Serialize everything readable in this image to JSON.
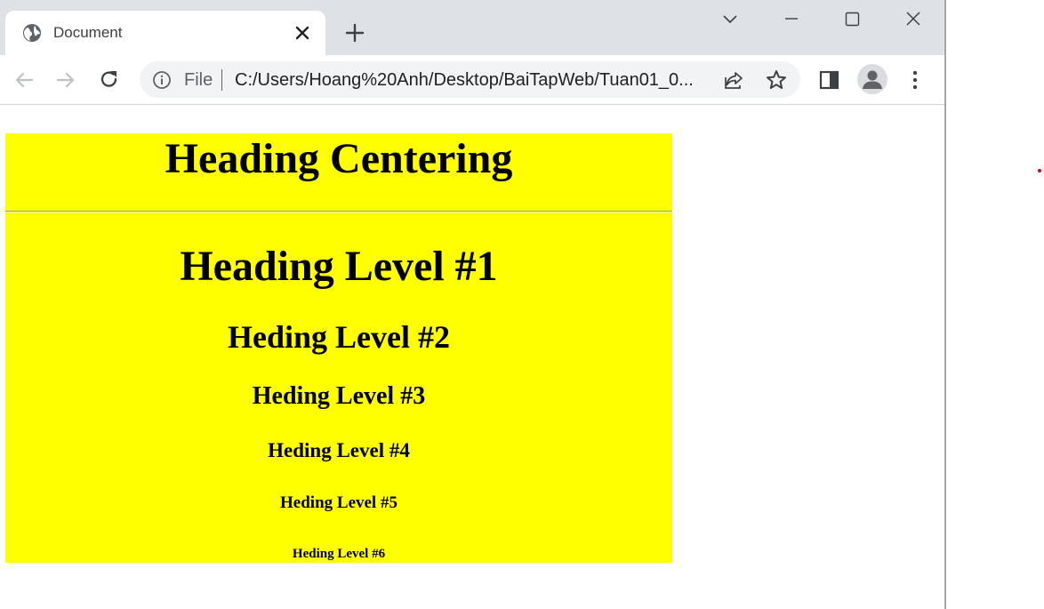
{
  "browser": {
    "tab": {
      "title": "Document",
      "favicon": "globe-icon",
      "close_icon": "close-icon"
    },
    "new_tab_icon": "plus-icon",
    "window_controls": [
      "chevron-down-icon",
      "minimize-icon",
      "maximize-icon",
      "close-icon"
    ],
    "toolbar": {
      "back_icon": "arrow-left-icon",
      "forward_icon": "arrow-right-icon",
      "reload_icon": "reload-icon",
      "omnibox": {
        "scheme_label": "File",
        "url": "C:/Users/Hoang%20Anh/Desktop/BaiTapWeb/Tuan01_0..."
      },
      "share_icon": "share-icon",
      "bookmark_icon": "star-icon",
      "side_panel_icon": "side-panel-icon",
      "profile_icon": "avatar-icon",
      "menu_icon": "kebab-menu-icon"
    }
  },
  "page": {
    "background_color": "#ffff00",
    "heading_centering": "Heading Centering",
    "headings": {
      "h1": "Heading Level #1",
      "h2": "Heding Level #2",
      "h3": "Heding Level #3",
      "h4": "Heding Level #4",
      "h5": "Heding Level #5",
      "h6": "Heding Level #6"
    }
  }
}
